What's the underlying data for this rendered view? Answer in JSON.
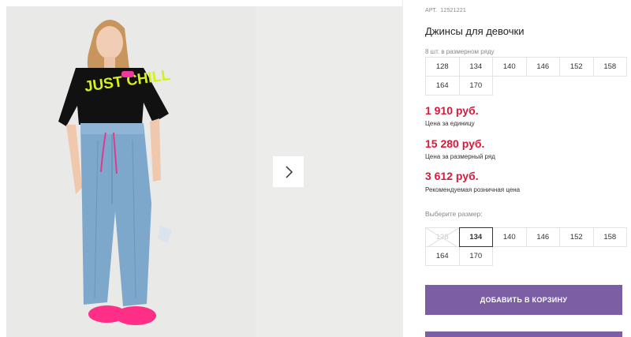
{
  "gallery": {
    "image_alt": "Girl in black graphic t-shirt, light blue jeans and pink sneakers",
    "shirt_print_text": "JUST CHILL"
  },
  "product": {
    "art_label": "АРТ.",
    "art_number": "12521221",
    "title": "Джинсы для девочки",
    "pack_note": "8 шт. в размерном ряду",
    "pack_sizes": [
      "128",
      "134",
      "140",
      "146",
      "152",
      "158",
      "164",
      "170"
    ],
    "prices": [
      {
        "value": "1 910 руб.",
        "label": "Цена за единицу"
      },
      {
        "value": "15 280 руб.",
        "label": "Цена за размерный ряд"
      },
      {
        "value": "3 612 руб.",
        "label": "Рекомендуемая розничная цена"
      }
    ],
    "choose_size_label": "Выберите размер:",
    "size_options": [
      {
        "label": "128",
        "state": "unavailable"
      },
      {
        "label": "134",
        "state": "selected"
      },
      {
        "label": "140",
        "state": "available"
      },
      {
        "label": "146",
        "state": "available"
      },
      {
        "label": "152",
        "state": "available"
      },
      {
        "label": "158",
        "state": "available"
      },
      {
        "label": "164",
        "state": "available"
      },
      {
        "label": "170",
        "state": "available"
      }
    ],
    "add_to_cart_label": "ДОБАВИТЬ В КОРЗИНУ"
  },
  "colors": {
    "price": "#d8193a",
    "button": "#7b5ea3"
  }
}
